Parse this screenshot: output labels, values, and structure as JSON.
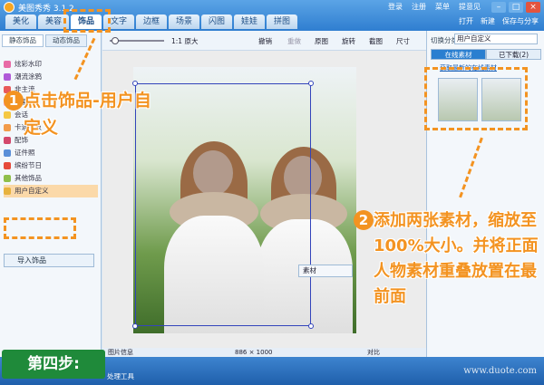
{
  "window": {
    "title": "美图秀秀 3.1.2",
    "top_links": [
      "登录",
      "注册",
      "菜单",
      "提意见"
    ],
    "min_glyph": "–",
    "max_glyph": "□",
    "close_glyph": "×"
  },
  "tabs": [
    "美化",
    "美容",
    "饰品",
    "文字",
    "边框",
    "场景",
    "闪图",
    "娃娃",
    "拼图"
  ],
  "actions": {
    "open": "打开",
    "new": "新建",
    "save": "保存与分享"
  },
  "left_panel": {
    "subtabs": [
      "静态饰品",
      "动态饰品"
    ],
    "categories": [
      "炫彩水印",
      "潮流涂鸦",
      "非主流",
      "可爱",
      "会话",
      "卡通形象",
      "配饰",
      "证件照",
      "缤纷节日",
      "其他饰品",
      "用户自定义"
    ],
    "import_button": "导入饰品"
  },
  "toolbar": {
    "zoom_original": "1:1 原大",
    "undo": "撤销",
    "redo": "重做",
    "original": "原图",
    "rotate": "旋转",
    "crop": "截图",
    "size": "尺寸"
  },
  "right_panel": {
    "category_label": "切换分类",
    "category_value": "用户自定义",
    "tabs": [
      "在线素材",
      "已下载(2)"
    ],
    "link": "获取最新的在线素材"
  },
  "status": {
    "info": "图片信息",
    "dimensions": "886 × 1000",
    "compare": "对比"
  },
  "bottom": {
    "tool": "处理工具",
    "watermark": "www.duote.com"
  },
  "popup": {
    "label": "素材"
  },
  "overlay": {
    "step1_number": "1",
    "step1_text": "点击饰品-用户自定义",
    "step2_number": "2",
    "step2_text": "添加两张素材，缩放至100%大小。并将正面人物素材重叠放置在最前面",
    "step_label": "第四步:",
    "accent": "#f39321"
  }
}
